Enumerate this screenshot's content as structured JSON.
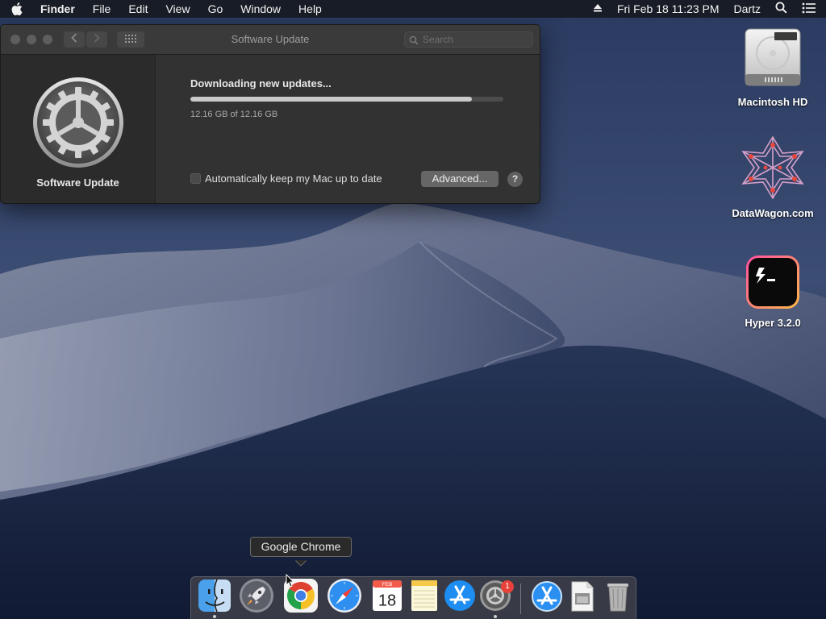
{
  "menubar": {
    "app_name": "Finder",
    "items": [
      "File",
      "Edit",
      "View",
      "Go",
      "Window",
      "Help"
    ],
    "datetime": "Fri Feb 18  11:23 PM",
    "user": "Dartz"
  },
  "window": {
    "title": "Software Update",
    "search_placeholder": "Search",
    "sidebar_label": "Software Update",
    "status_title": "Downloading new updates...",
    "progress_fraction": 0.9,
    "size_text": "12.16 GB of 12.16 GB",
    "auto_update_label": "Automatically keep my Mac up to date",
    "auto_update_checked": false,
    "advanced_label": "Advanced...",
    "help_label": "?"
  },
  "desktop": {
    "icons": [
      {
        "label": "Macintosh HD",
        "icon": "hard-drive-icon"
      },
      {
        "label": "DataWagon.com",
        "icon": "datawagon-icon"
      },
      {
        "label": "Hyper 3.2.0",
        "icon": "hyper-terminal-icon"
      }
    ]
  },
  "tooltip": {
    "text": "Google Chrome"
  },
  "calendar": {
    "month": "FEB",
    "day": "18"
  },
  "dock": {
    "items": [
      "Finder",
      "Launchpad",
      "Google Chrome",
      "Safari",
      "Calendar",
      "Notes",
      "App Store",
      "System Preferences",
      "App Store Downloads",
      "Preview",
      "Trash"
    ],
    "system_preferences_badge": "1"
  },
  "colors": {
    "menubar_bg": "#16181e",
    "window_bg": "#323232",
    "badge_red": "#e8413a",
    "hyper_gradient_start": "#ff4fa0",
    "hyper_gradient_end": "#ffb84a"
  }
}
